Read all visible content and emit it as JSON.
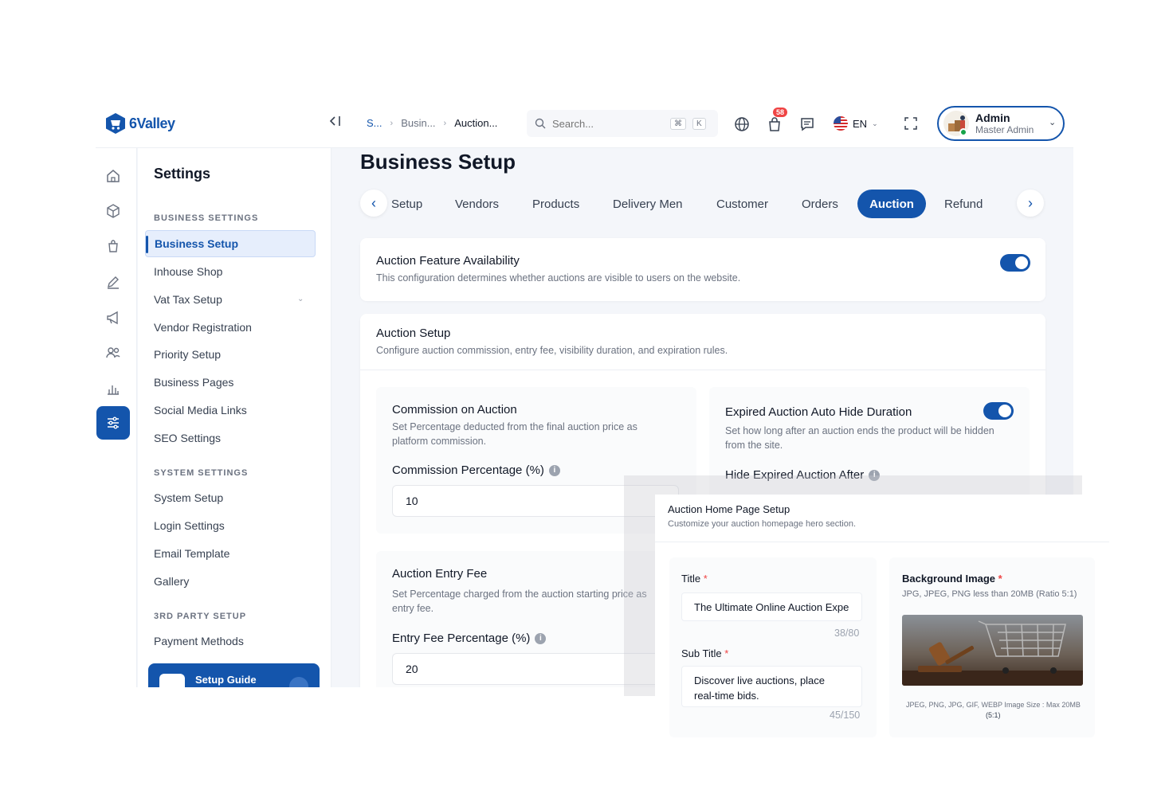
{
  "brand": {
    "name": "6Valley",
    "accent": "#1455ac"
  },
  "header": {
    "breadcrumb": [
      "S...",
      "Busin...",
      "Auction..."
    ],
    "search": {
      "placeholder": "Search...",
      "shortcut_mod": "⌘",
      "shortcut_key": "K"
    },
    "notification_count": "58",
    "language": "EN",
    "profile": {
      "name": "Admin",
      "role": "Master Admin"
    }
  },
  "rail": {
    "icons": [
      "home-icon",
      "box-icon",
      "bag-icon",
      "pen-icon",
      "megaphone-icon",
      "users-icon",
      "bar-chart-icon",
      "sliders-icon"
    ]
  },
  "sidebar": {
    "title": "Settings",
    "business_section": "BUSINESS SETTINGS",
    "business_items": [
      "Business Setup",
      "Inhouse Shop",
      "Vat Tax Setup",
      "Vendor Registration",
      "Priority Setup",
      "Business Pages",
      "Social Media Links",
      "SEO Settings"
    ],
    "system_section": "SYSTEM SETTINGS",
    "system_items": [
      "System Setup",
      "Login Settings",
      "Email Template",
      "Gallery"
    ],
    "third_party_section": "3RD PARTY SETUP",
    "third_party_items": [
      "Payment Methods"
    ],
    "setup_guide": "Setup Guide"
  },
  "main": {
    "title": "Business Setup",
    "tabs": [
      "Setup",
      "Vendors",
      "Products",
      "Delivery Men",
      "Customer",
      "Orders",
      "Auction",
      "Refund"
    ],
    "active_tab": "Auction",
    "availability": {
      "title": "Auction Feature Availability",
      "desc": "This configuration determines whether auctions are visible to users on the website.",
      "enabled": true
    },
    "auction_setup": {
      "title": "Auction Setup",
      "desc": "Configure auction commission, entry fee, visibility duration, and expiration rules."
    },
    "commission": {
      "title": "Commission on Auction",
      "desc_line1": "Set Percentage deducted from the final auction price as",
      "desc_line2": "platform commission.",
      "label": "Commission Percentage (%)",
      "value": "10"
    },
    "expired": {
      "title": "Expired Auction Auto Hide Duration",
      "desc_line1": "Set how long after an auction ends the product will be hidden",
      "desc_line2": "from the site.",
      "label": "Hide Expired Auction After",
      "enabled": true
    },
    "entry_fee": {
      "title": "Auction Entry Fee",
      "desc_line1": "Set Percentage charged from the auction starting price as",
      "desc_line2": "entry fee.",
      "label": "Entry Fee Percentage (%)",
      "value": "20"
    }
  },
  "overlay": {
    "title": "Auction Home Page Setup",
    "desc": "Customize your auction homepage hero section.",
    "title_label": "Title",
    "title_value": "The Ultimate Online Auction Expe",
    "title_counter": "38/80",
    "subtitle_label": "Sub Title",
    "subtitle_line1": "Discover live auctions, place",
    "subtitle_line2": "real-time bids.",
    "subtitle_counter": "45/150",
    "bg_label": "Background Image",
    "bg_hint": "JPG, JPEG, PNG less than 20MB (Ratio 5:1)",
    "bg_footer": "JPEG, PNG, JPG, GIF, WEBP Image Size : Max 20MB",
    "bg_ratio": "(5:1)",
    "required_mark": "*"
  }
}
